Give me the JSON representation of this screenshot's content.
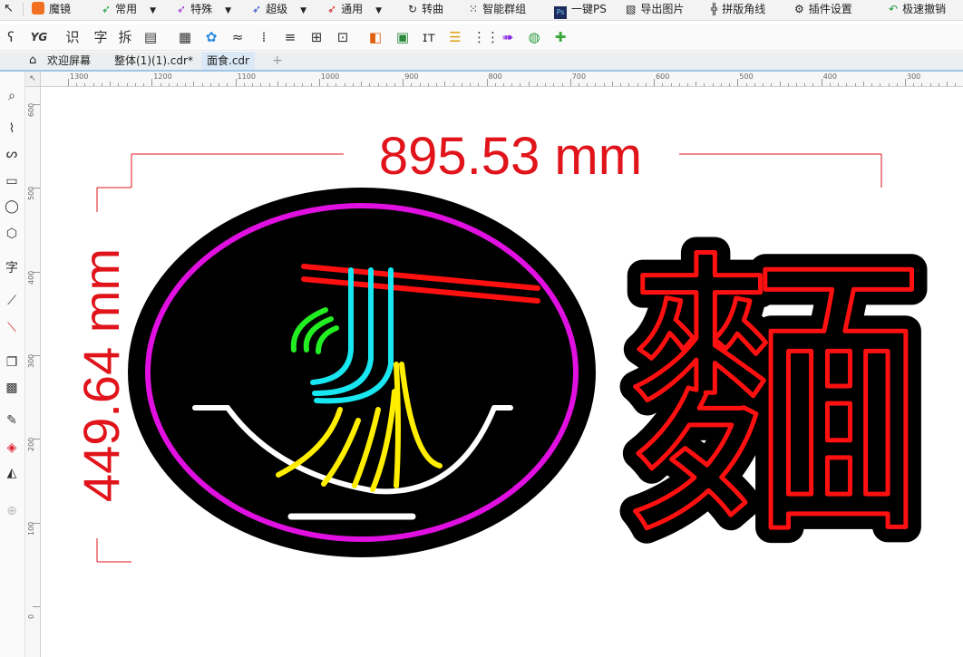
{
  "menubar": {
    "items": [
      {
        "label": "魔镜",
        "icon": "mirror-icon"
      },
      {
        "label": "常用",
        "icon": "pen-icon",
        "dropdown": true
      },
      {
        "label": "特殊",
        "icon": "pen-icon",
        "dropdown": true
      },
      {
        "label": "超级",
        "icon": "pen-icon",
        "dropdown": true
      },
      {
        "label": "通用",
        "icon": "pen-icon",
        "dropdown": true
      },
      {
        "label": "转曲",
        "icon": "convert-curve-icon"
      },
      {
        "label": "智能群组",
        "icon": "smart-group-icon"
      },
      {
        "label": "一键PS",
        "icon": "ps-icon"
      },
      {
        "label": "导出图片",
        "icon": "image-icon"
      },
      {
        "label": "拼版角线",
        "icon": "crop-mark-icon"
      },
      {
        "label": "插件设置",
        "icon": "gear-icon"
      },
      {
        "label": "极速撤销",
        "icon": "undo-icon"
      }
    ]
  },
  "toolbar2": {
    "yg": "YG",
    "chars": [
      "识",
      "字",
      "拆"
    ]
  },
  "tabs": [
    {
      "label": "欢迎屏幕"
    },
    {
      "label": "整体(1)(1).cdr*"
    },
    {
      "label": "面食.cdr"
    }
  ],
  "hruler": {
    "labels": [
      "1300",
      "1200",
      "1100",
      "1000",
      "900",
      "800",
      "700",
      "600",
      "500",
      "400",
      "300"
    ]
  },
  "vruler": {
    "labels": [
      "600",
      "500",
      "400",
      "300",
      "200",
      "100",
      "0"
    ]
  },
  "drawing": {
    "width_dimension": "895.53 mm",
    "height_dimension": "449.64 mm",
    "sign_character": "麵",
    "colors": {
      "dimension": "#e0141a",
      "ring": "#e010e0",
      "chopsticks": "#ff1010",
      "noodle_cyan": "#18e6f0",
      "noodle_green": "#22ee22",
      "noodle_yellow": "#ffee00",
      "bowl": "#ffffff",
      "background": "#000000"
    }
  }
}
